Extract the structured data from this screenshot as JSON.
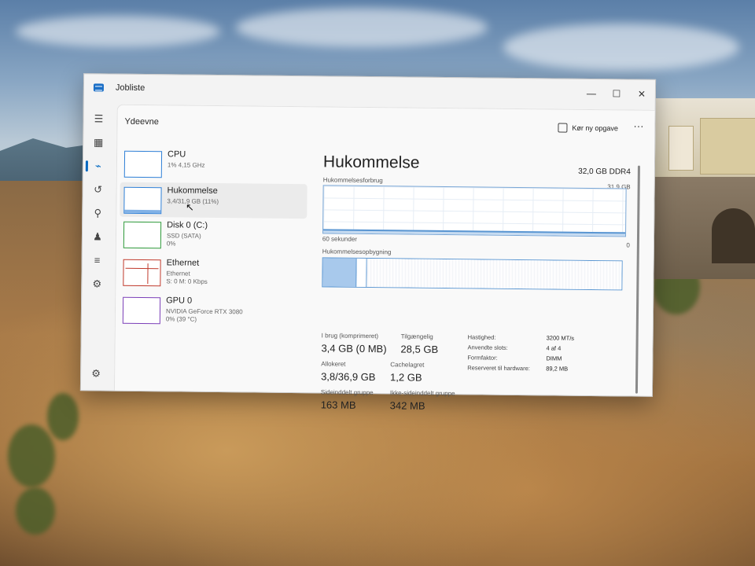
{
  "window": {
    "title": "Jobliste"
  },
  "controls": {
    "minimize": "—",
    "maximize": "☐",
    "close": "✕"
  },
  "page": {
    "title": "Ydeevne"
  },
  "toolbar": {
    "run_task": "Kør ny opgave",
    "more": "···"
  },
  "perf_list": [
    {
      "name": "CPU",
      "sub1": "1% 4,15 GHz",
      "sub2": "",
      "accent": "#2e7fd6"
    },
    {
      "name": "Hukommelse",
      "sub1": "3,4/31,9 GB (11%)",
      "sub2": "",
      "accent": "#2e7fd6"
    },
    {
      "name": "Disk 0 (C:)",
      "sub1": "SSD (SATA)",
      "sub2": "0%",
      "accent": "#2e9a3a"
    },
    {
      "name": "Ethernet",
      "sub1": "Ethernet",
      "sub2": "S: 0 M: 0 Kbps",
      "accent": "#c0392b"
    },
    {
      "name": "GPU 0",
      "sub1": "NVIDIA GeForce RTX 3080",
      "sub2": "0% (39 °C)",
      "accent": "#7b3fb8"
    }
  ],
  "detail": {
    "title": "Hukommelse",
    "spec": "32,0 GB DDR4",
    "usage_label": "Hukommelsesforbrug",
    "usage_max": "31,9 GB",
    "usage_fraction": 0.11,
    "time_left": "60 sekunder",
    "time_right": "0",
    "composition_label": "Hukommelsesopbygning",
    "stats": {
      "in_use_label": "I brug (komprimeret)",
      "in_use": "3,4 GB (0 MB)",
      "available_label": "Tilgængelig",
      "available": "28,5 GB",
      "committed_label": "Allokeret",
      "committed": "3,8/36,9 GB",
      "cached_label": "Cachelagret",
      "cached": "1,2 GB",
      "paged_label": "Sideinddelt gruppe",
      "paged": "163 MB",
      "nonpaged_label": "Ikke-sideinddelt gruppe",
      "nonpaged": "342 MB"
    },
    "props": [
      {
        "k": "Hastighed:",
        "v": "3200 MT/s"
      },
      {
        "k": "Anvendte slots:",
        "v": "4 af 4"
      },
      {
        "k": "Formfaktor:",
        "v": "DIMM"
      },
      {
        "k": "Reserveret til hardware:",
        "v": "89,2 MB"
      }
    ]
  },
  "colors": {
    "accent": "#0067c0",
    "graph_line": "#5a96d2"
  }
}
